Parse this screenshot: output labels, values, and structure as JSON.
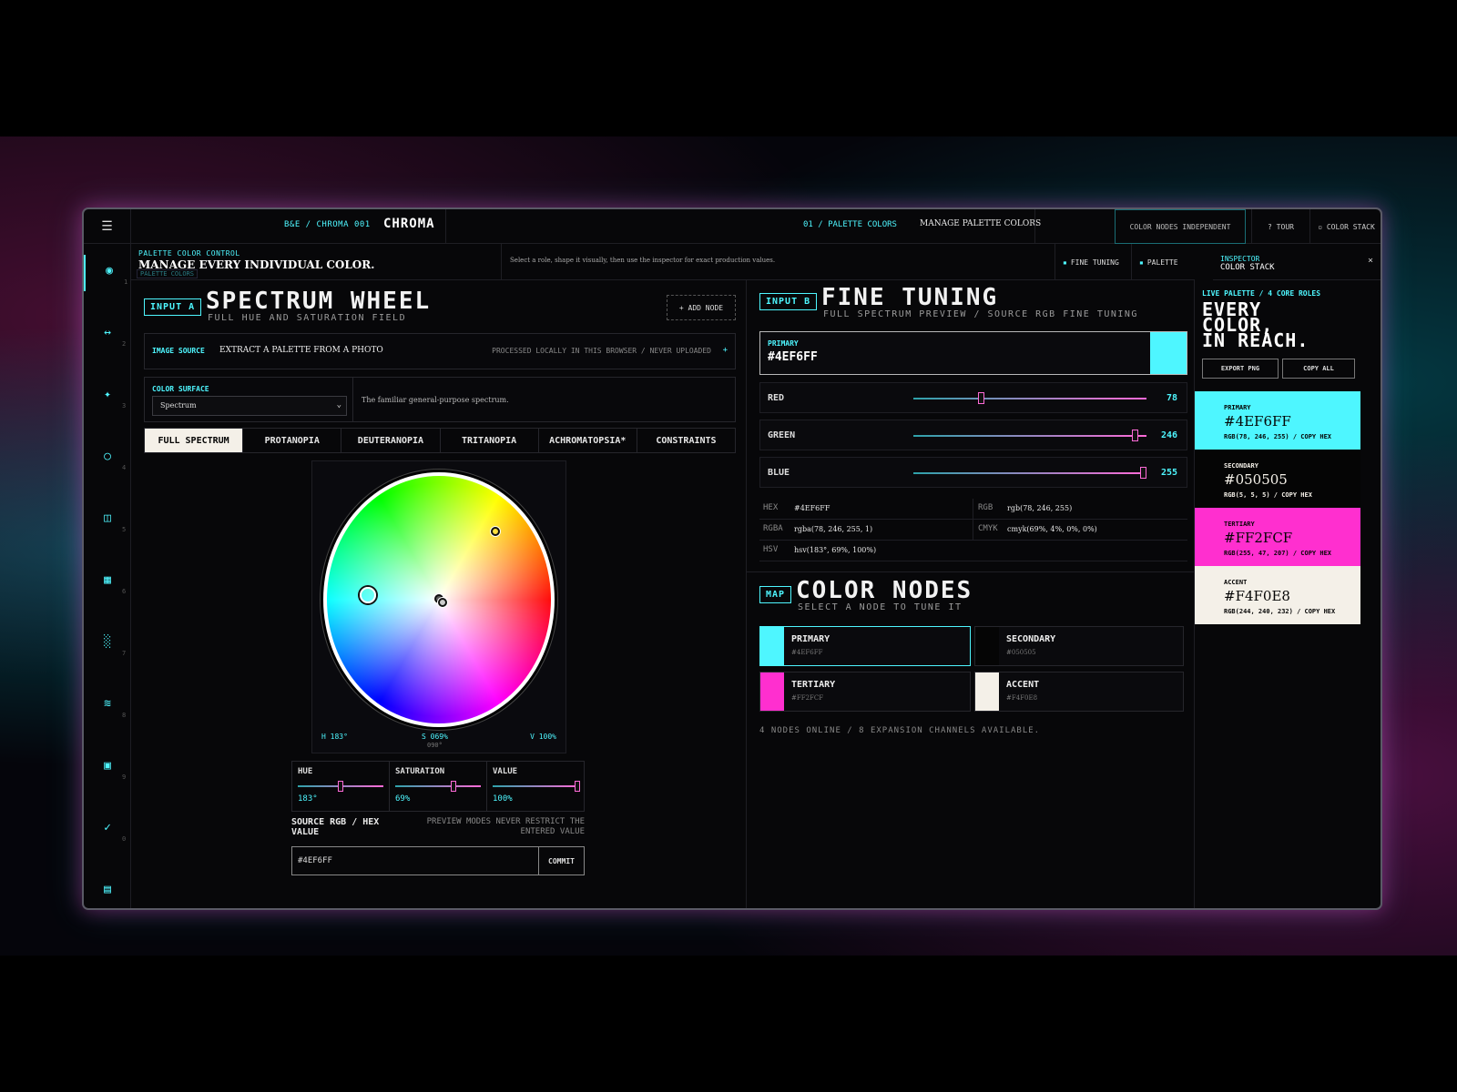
{
  "topbar": {
    "crumb": "B&E / CHROMA 001",
    "brand": "CHROMA",
    "crumb2": "01 / PALETTE COLORS",
    "crumb2b": "MANAGE PALETTE COLORS",
    "nodes_mode": "COLOR NODES INDEPENDENT",
    "tour": "? TOUR",
    "stack": "▫ COLOR STACK"
  },
  "header": {
    "kicker": "PALETTE COLOR CONTROL",
    "title": "MANAGE EVERY INDIVIDUAL COLOR.",
    "ghost": "PALETTE COLORS",
    "desc": "Select a role, shape it visually, then use the inspector for exact production values.",
    "fine": "FINE TUNING",
    "palette": "PALETTE"
  },
  "inspector": {
    "kicker": "INSPECTOR",
    "title": "COLOR STACK",
    "close": "×"
  },
  "rail": [
    {
      "icon": "◉",
      "n": "1"
    },
    {
      "icon": "↔",
      "n": "2"
    },
    {
      "icon": "✦",
      "n": "3"
    },
    {
      "icon": "○",
      "n": "4"
    },
    {
      "icon": "◫",
      "n": "5"
    },
    {
      "icon": "▦",
      "n": "6"
    },
    {
      "icon": "░",
      "n": "7"
    },
    {
      "icon": "≋",
      "n": "8"
    },
    {
      "icon": "▣",
      "n": "9"
    },
    {
      "icon": "✓",
      "n": "0"
    },
    {
      "icon": "▤",
      "n": ""
    }
  ],
  "inputA": {
    "tag": "INPUT A",
    "title": "SPECTRUM WHEEL",
    "subtitle": "FULL HUE AND SATURATION FIELD",
    "add": "+ ADD NODE",
    "image_source": {
      "key": "IMAGE SOURCE",
      "label": "EXTRACT A PALETTE FROM A PHOTO",
      "note": "PROCESSED LOCALLY IN THIS BROWSER / NEVER UPLOADED",
      "plus": "+"
    },
    "surface": {
      "key": "COLOR SURFACE",
      "value": "Spectrum",
      "desc": "The familiar general-purpose spectrum."
    },
    "tabs": [
      "FULL SPECTRUM",
      "PROTANOPIA",
      "DEUTERANOPIA",
      "TRITANOPIA",
      "ACHROMATOPSIA*",
      "CONSTRAINTS"
    ],
    "wheel": {
      "h": "H 183°",
      "s": "S 069%",
      "angle": "090°",
      "v": "V 100%"
    },
    "hsv": [
      {
        "label": "HUE",
        "value": "183°",
        "level": 0.51
      },
      {
        "label": "SATURATION",
        "value": "69%",
        "level": 0.69
      },
      {
        "label": "VALUE",
        "value": "100%",
        "level": 1.0
      }
    ],
    "source_label": "SOURCE RGB / HEX VALUE",
    "source_note": "PREVIEW MODES NEVER RESTRICT THE ENTERED VALUE",
    "hex_value": "#4EF6FF",
    "commit": "COMMIT"
  },
  "inputB": {
    "tag": "INPUT B",
    "title": "FINE TUNING",
    "subtitle": "FULL SPECTRUM PREVIEW / SOURCE RGB FINE TUNING",
    "primary": {
      "key": "PRIMARY",
      "value": "#4EF6FF"
    },
    "rgb": [
      {
        "label": "RED",
        "value": "78",
        "level": 0.306
      },
      {
        "label": "GREEN",
        "value": "246",
        "level": 0.965
      },
      {
        "label": "BLUE",
        "value": "255",
        "level": 1.0
      }
    ],
    "conv": {
      "hex_k": "HEX",
      "hex": "#4EF6FF",
      "rgb_k": "RGB",
      "rgb": "rgb(78, 246, 255)",
      "rgba_k": "RGBA",
      "rgba": "rgba(78, 246, 255, 1)",
      "cmyk_k": "CMYK",
      "cmyk": "cmyk(69%, 4%, 0%, 0%)",
      "hsv_k": "HSV",
      "hsv": "hsv(183°, 69%, 100%)"
    }
  },
  "map": {
    "tag": "MAP",
    "title": "COLOR NODES",
    "subtitle": "SELECT A NODE TO TUNE IT",
    "nodes": [
      {
        "label": "PRIMARY",
        "hex": "#4EF6FF",
        "color": "#4EF6FF"
      },
      {
        "label": "SECONDARY",
        "hex": "#050505",
        "color": "#050505"
      },
      {
        "label": "TERTIARY",
        "hex": "#FF2FCF",
        "color": "#FF2FCF"
      },
      {
        "label": "ACCENT",
        "hex": "#F4F0E8",
        "color": "#F4F0E8"
      }
    ],
    "online": "4 NODES ONLINE / 8 EXPANSION CHANNELS AVAILABLE."
  },
  "live": {
    "kicker": "LIVE PALETTE / 4 CORE ROLES",
    "headline": [
      "EVERY",
      "COLOR,",
      "IN REACH."
    ],
    "export": "EXPORT PNG",
    "copy_all": "COPY ALL",
    "swatches": [
      {
        "role": "PRIMARY",
        "hex": "#4EF6FF",
        "rgb": "RGB(78, 246, 255) / COPY HEX",
        "bg": "#4EF6FF",
        "fg": "#050505"
      },
      {
        "role": "SECONDARY",
        "hex": "#050505",
        "rgb": "RGB(5, 5, 5) / COPY HEX",
        "bg": "#050505",
        "fg": "#F4F0E8"
      },
      {
        "role": "TERTIARY",
        "hex": "#FF2FCF",
        "rgb": "RGB(255, 47, 207) / COPY HEX",
        "bg": "#FF2FCF",
        "fg": "#050505"
      },
      {
        "role": "ACCENT",
        "hex": "#F4F0E8",
        "rgb": "RGB(244, 240, 232) / COPY HEX",
        "bg": "#F4F0E8",
        "fg": "#050505"
      }
    ]
  },
  "colors": {
    "cyan": "#4EF6FF",
    "pink": "#FF2FCF",
    "black": "#050505",
    "cream": "#F4F0E8"
  }
}
